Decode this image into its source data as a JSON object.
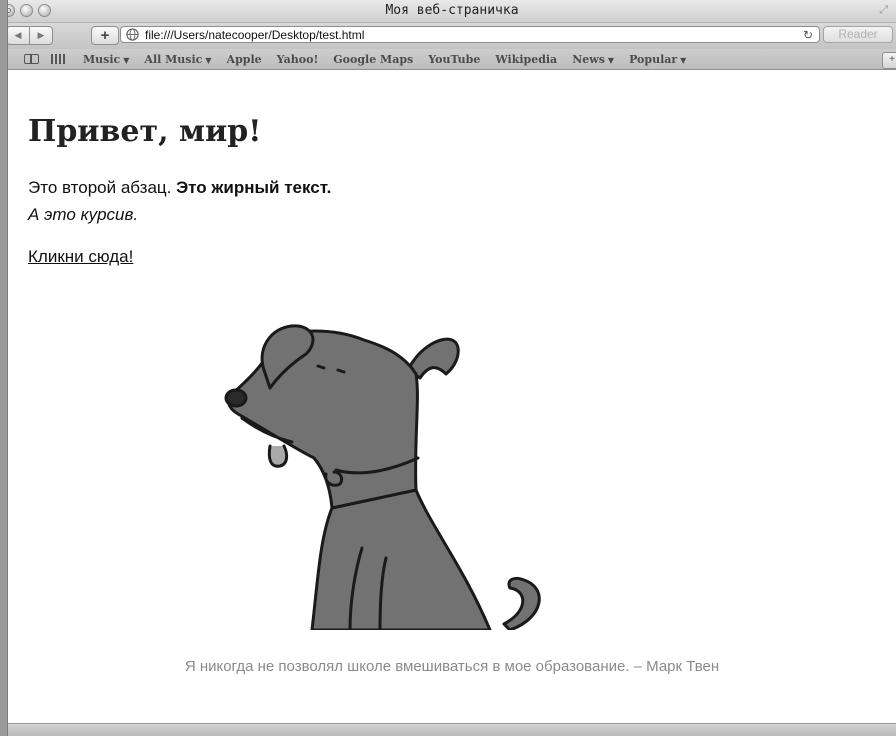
{
  "window": {
    "title": "Моя веб-страничка"
  },
  "toolbar": {
    "back_label": "◀",
    "forward_label": "▶",
    "new_tab_label": "+",
    "url": "file:///Users/natecooper/Desktop/test.html",
    "reload_label": "↻",
    "reader_label": "Reader"
  },
  "bookmarks": {
    "items": [
      {
        "label": "Music",
        "caret": "▼"
      },
      {
        "label": "All Music",
        "caret": "▼"
      },
      {
        "label": "Apple",
        "caret": ""
      },
      {
        "label": "Yahoo!",
        "caret": ""
      },
      {
        "label": "Google Maps",
        "caret": ""
      },
      {
        "label": "YouTube",
        "caret": ""
      },
      {
        "label": "Wikipedia",
        "caret": ""
      },
      {
        "label": "News",
        "caret": "▼"
      },
      {
        "label": "Popular",
        "caret": "▼"
      }
    ],
    "add_label": "+"
  },
  "page": {
    "heading": "Привет, мир!",
    "paragraph_text": "Это второй абзац. ",
    "paragraph_bold": "Это жирный текст.",
    "paragraph_italic": "А это курсив.",
    "link_text": "Кликни сюда!",
    "caption": "Я никогда не позволял школе вмешиваться в мое образование. – Марк Твен"
  }
}
